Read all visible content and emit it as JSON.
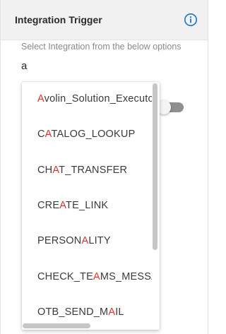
{
  "header": {
    "title": "Integration Trigger",
    "info_icon": "info-circle-icon",
    "accent": "#1a73c8"
  },
  "hint": "Select Integration from the below options",
  "search": {
    "value": "a"
  },
  "dropdown": {
    "highlight_color": "#e0302a",
    "options": [
      {
        "pre": "",
        "match": "A",
        "post": "volin_Solution_Executor"
      },
      {
        "pre": "C",
        "match": "A",
        "post": "TALOG_LOOKUP"
      },
      {
        "pre": "CH",
        "match": "A",
        "post": "T_TRANSFER"
      },
      {
        "pre": "CRE",
        "match": "A",
        "post": "TE_LINK"
      },
      {
        "pre": "PERSON",
        "match": "A",
        "post": "LITY"
      },
      {
        "pre": "CHECK_TE",
        "match": "A",
        "post": "MS_MESSAGE"
      },
      {
        "pre": "OTB_SEND_M",
        "match": "A",
        "post": "IL"
      }
    ]
  },
  "toggle": {
    "state": "off"
  }
}
